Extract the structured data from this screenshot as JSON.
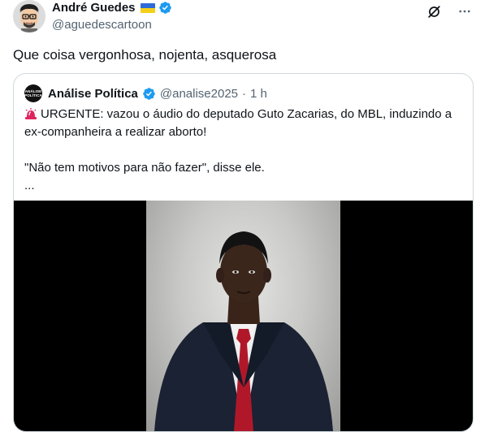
{
  "author": {
    "name": "André Guedes",
    "handle": "@aguedescartoon"
  },
  "tweet": {
    "text": "Que coisa vergonhosa, nojenta, asquerosa"
  },
  "icons": {
    "grok": "grok-icon",
    "more": "more-icon",
    "verified": "verified-badge-icon",
    "flag": "ukraine-flag-icon",
    "siren": "rotating-light-icon"
  },
  "quote": {
    "avatar_text_line1": "ANÁLISE",
    "avatar_text_line2": "POLÍTICA",
    "name": "Análise Política",
    "handle": "@analise2025",
    "separator": "·",
    "time": "1 h",
    "body_line1": "URGENTE: vazou o áudio do deputado Guto Zacarias, do MBL, induzindo a ex-companheira a realizar aborto!",
    "body_line2": "\"Não tem motivos para não fazer\", disse ele.",
    "body_line3": "..."
  },
  "colors": {
    "verified": "#1d9bf0",
    "secondary_text": "#536471",
    "border": "#cfd9de",
    "siren": "#e0245e"
  }
}
